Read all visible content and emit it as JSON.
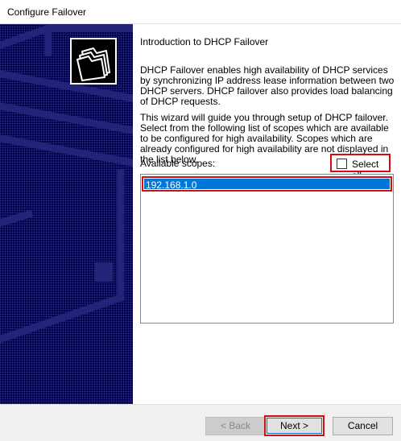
{
  "window": {
    "title": "Configure Failover"
  },
  "wizard": {
    "heading": "Introduction to DHCP Failover",
    "paragraph1": "DHCP Failover enables high availability of DHCP services by synchronizing IP address lease information between two DHCP servers. DHCP failover also provides load balancing of DHCP requests.",
    "paragraph2": "This wizard will guide you through setup of DHCP failover. Select from the following list of scopes which are available to be configured for high availability. Scopes which are already configured for high availability are not displayed in the list below.",
    "scopes_label": "Available scopes:",
    "select_all_label": "Select all.",
    "select_all_checked": false,
    "scopes": [
      {
        "name": "192.168.1.0",
        "selected": true
      }
    ]
  },
  "footer": {
    "back_label": "< Back",
    "next_label": "Next >",
    "cancel_label": "Cancel"
  },
  "colors": {
    "sidebar_bg": "#00004a",
    "selection": "#0078d7",
    "highlight": "#d01010"
  },
  "icons": {
    "wizard_logo": "folders-icon"
  }
}
